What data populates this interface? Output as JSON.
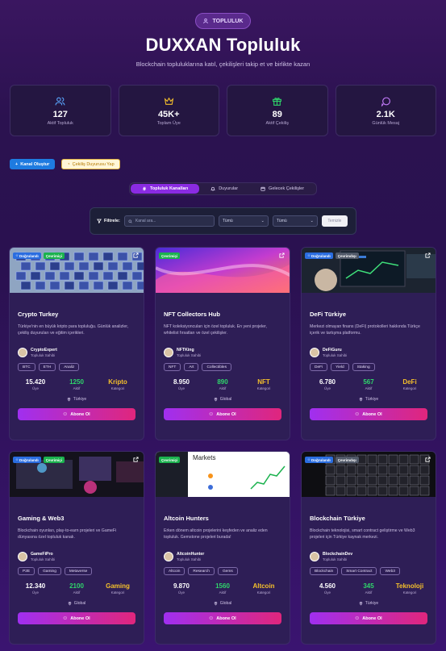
{
  "hero": {
    "pill": "TOPLULUK",
    "title": "DUXXAN Topluluk",
    "subtitle": "Blockchain topluluklarına katıl, çekilişleri takip et ve birlikte kazan"
  },
  "stats": [
    {
      "value": "127",
      "label": "Aktif Topluluk",
      "icon": "users-icon",
      "color": "#5aa7ff"
    },
    {
      "value": "45K+",
      "label": "Toplam Üye",
      "icon": "crown-icon",
      "color": "#f5c02b"
    },
    {
      "value": "89",
      "label": "Aktif Çekiliş",
      "icon": "gift-icon",
      "color": "#2fd66b"
    },
    {
      "value": "2.1K",
      "label": "Günlük Mesaj",
      "icon": "chat-icon",
      "color": "#c77dff"
    }
  ],
  "actions": {
    "create": "Kanal Oluştur",
    "raffle": "Çekiliş Duyurusu Yap"
  },
  "tabs": [
    {
      "label": "Topluluk Kanalları",
      "active": true,
      "icon": "hash-icon"
    },
    {
      "label": "Duyurular",
      "active": false,
      "icon": "bell-icon"
    },
    {
      "label": "Gelecek Çekilişler",
      "active": false,
      "icon": "calendar-icon"
    }
  ],
  "filter": {
    "label": "Filtrele:",
    "search_placeholder": "Kanal ara...",
    "select1": "Tümü",
    "select2": "Tümü",
    "button": "Temizle"
  },
  "cards": [
    {
      "title": "Crypto Turkey",
      "desc": "Türkiye'nin en büyük kripto para topluluğu. Günlük analizler, çekiliş duyuruları ve eğitim içerikleri.",
      "badges": [
        "Doğrulandı",
        "Çevrimiçi"
      ],
      "owner": "CryptoExpert",
      "role": "Topluluk Sahibi",
      "tags": [
        "BTC",
        "ETH",
        "Analiz"
      ],
      "members": "15.420",
      "members_l": "Üye",
      "active": "1250",
      "active_l": "Aktif",
      "category": "Kripto",
      "category_l": "Kategori",
      "location": "Türkiye",
      "cta": "Abone Ol",
      "img": "cubes"
    },
    {
      "title": "NFT Collectors Hub",
      "desc": "NFT koleksiyoncuları için özel topluluk. En yeni projeler, whitelist fırsatları ve özel çekilişler.",
      "badges": [
        "Çevrimiçi"
      ],
      "owner": "NFTKing",
      "role": "Topluluk Sahibi",
      "tags": [
        "NFT",
        "Art",
        "Collectibles"
      ],
      "members": "8.950",
      "members_l": "Üye",
      "active": "890",
      "active_l": "Aktif",
      "category": "NFT",
      "category_l": "Kategori",
      "location": "Global",
      "cta": "Abone Ol",
      "img": "wave"
    },
    {
      "title": "DeFi Türkiye",
      "desc": "Merkezi olmayan finans (DeFi) protokolleri hakkında Türkçe içerik ve tartışma platformu.",
      "badges": [
        "Doğrulandı",
        "Çevrimdışı"
      ],
      "owner": "DeFiGuru",
      "role": "Topluluk Sahibi",
      "tags": [
        "DeFi",
        "Yield",
        "Staking"
      ],
      "members": "6.780",
      "members_l": "Üye",
      "active": "567",
      "active_l": "Aktif",
      "category": "DeFi",
      "category_l": "Kategori",
      "location": "Türkiye",
      "cta": "Abone Ol",
      "img": "laptop"
    },
    {
      "title": "Gaming & Web3",
      "desc": "Blockchain oyunları, play-to-earn projeleri ve GameFi dünyasına özel topluluk kanalı.",
      "badges": [
        "Doğrulandı",
        "Çevrimiçi"
      ],
      "owner": "GameFiPro",
      "role": "Topluluk Sahibi",
      "tags": [
        "P2E",
        "Gaming",
        "Metaverse"
      ],
      "members": "12.340",
      "members_l": "Üye",
      "active": "2100",
      "active_l": "Aktif",
      "category": "Gaming",
      "category_l": "Kategori",
      "location": "Global",
      "cta": "Abone Ol",
      "img": "gaming"
    },
    {
      "title": "Altcoin Hunters",
      "desc": "Erken dönem altcoin projelerini keşfeden ve analiz eden topluluk. Gemstone projeleri burada!",
      "badges": [
        "Çevrimiçi"
      ],
      "owner": "AltcoinHunter",
      "role": "Topluluk Sahibi",
      "tags": [
        "Altcoin",
        "Research",
        "Gems"
      ],
      "members": "9.870",
      "members_l": "Üye",
      "active": "1560",
      "active_l": "Aktif",
      "category": "Altcoin",
      "category_l": "Kategori",
      "location": "Global",
      "cta": "Abone Ol",
      "img": "markets"
    },
    {
      "title": "Blockchain Türkiye",
      "desc": "Blockchain teknolojisi, smart contract geliştirme ve Web3 projeleri için Türkiye kaynak merkezi.",
      "badges": [
        "Doğrulandı",
        "Çevrimdışı"
      ],
      "owner": "BlockchainDev",
      "role": "Topluluk Sahibi",
      "tags": [
        "Blockchain",
        "Smart Contract",
        "Web3"
      ],
      "members": "4.560",
      "members_l": "Üye",
      "active": "345",
      "active_l": "Aktif",
      "category": "Teknoloji",
      "category_l": "Kategori",
      "location": "Türkiye",
      "cta": "Abone Ol",
      "img": "grid"
    }
  ]
}
